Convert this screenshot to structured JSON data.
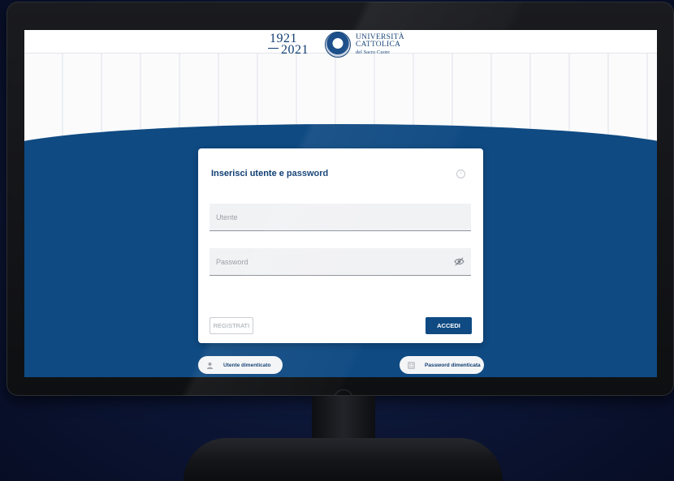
{
  "header": {
    "logo_years_top": "1921",
    "logo_years_bottom": "2021",
    "university_line1": "UNIVERSITÀ",
    "university_line2": "CATTOLICA",
    "university_line3": "del Sacro Cuore"
  },
  "login_card": {
    "title": "Inserisci utente e password",
    "username_placeholder": "Utente",
    "password_placeholder": "Password",
    "register_label": "REGISTRATI",
    "login_label": "ACCEDI"
  },
  "links": {
    "forgot_user": "Utente dimenticato",
    "forgot_password": "Password dimenticata"
  },
  "colors": {
    "brand_blue": "#0f4a82",
    "background_navy": "#0c1636"
  },
  "icons": [
    "info-icon",
    "eye-slash-icon",
    "user-icon",
    "keypad-icon"
  ]
}
